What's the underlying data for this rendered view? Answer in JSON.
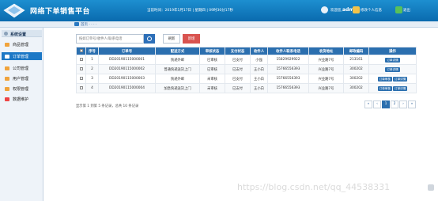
{
  "header": {
    "title": "网络下单销售平台",
    "datetime": "当前时间：2019年1月17日 | 星期四 | 09时30分17秒",
    "welcome_prefix": "欢迎您,",
    "username": "admin",
    "messages_label": "修改个人信息",
    "exit_label": "退出"
  },
  "breadcrumb": {
    "label": "首页 · · · ·"
  },
  "sidebar": {
    "title": "系统设置",
    "items": [
      {
        "label": "商品管理",
        "icon": "box-icon",
        "color": "#f0a33c"
      },
      {
        "label": "订单管理",
        "icon": "order-icon",
        "color": "#ffffff",
        "active": true
      },
      {
        "label": "公司管理",
        "icon": "company-icon",
        "color": "#f0a33c"
      },
      {
        "label": "用户管理",
        "icon": "user-icon",
        "color": "#f0a33c"
      },
      {
        "label": "权限管理",
        "icon": "permission-icon",
        "color": "#f0a33c"
      },
      {
        "label": "数据维护",
        "icon": "database-icon",
        "color": "#e44"
      }
    ]
  },
  "toolbar": {
    "search_placeholder": "按如订单号/收件人/联系电话",
    "refresh_label": "刷新",
    "new_label": "新增"
  },
  "table": {
    "columns": [
      "序号",
      "订单号",
      "配送方式",
      "审核状态",
      "支付状态",
      "收件人",
      "收件人联系电话",
      "收货地址",
      "邮政编码",
      "操作"
    ],
    "rows": [
      {
        "no": "1",
        "order": "DD20190115000001",
        "delivery": "快递外邮",
        "review": "已审核",
        "pay": "已支付",
        "receiver": "小强",
        "phone": "15829929922",
        "addr": "兴业路7号",
        "zip": "213161",
        "ops": [
          "订单详情"
        ]
      },
      {
        "no": "2",
        "order": "DD20190115000002",
        "delivery": "普通快递送货上门",
        "review": "已审核",
        "pay": "已支付",
        "receiver": "王小白",
        "phone": "15766556393",
        "addr": "兴业路7号",
        "zip": "300202",
        "ops": [
          "订单详情"
        ]
      },
      {
        "no": "3",
        "order": "DD20190115000003",
        "delivery": "快递外邮",
        "review": "未审核",
        "pay": "已支付",
        "receiver": "王小白",
        "phone": "15766556393",
        "addr": "兴业路7号",
        "zip": "300202",
        "ops": [
          "订单审核",
          "订单详情"
        ]
      },
      {
        "no": "4",
        "order": "DD20190115000004",
        "delivery": "加急快递送货上门",
        "review": "未审核",
        "pay": "已支付",
        "receiver": "王小白",
        "phone": "15766556393",
        "addr": "兴业路7号",
        "zip": "300202",
        "ops": [
          "订单审核",
          "订单详情"
        ]
      }
    ]
  },
  "footer": {
    "summary": "显示第 1 到第 5 条记录，总共 10 条记录",
    "pages": [
      "«",
      "‹",
      "1",
      "2",
      "›",
      "»"
    ]
  },
  "watermark": "https://blog.csdn.net/qq_44538331"
}
